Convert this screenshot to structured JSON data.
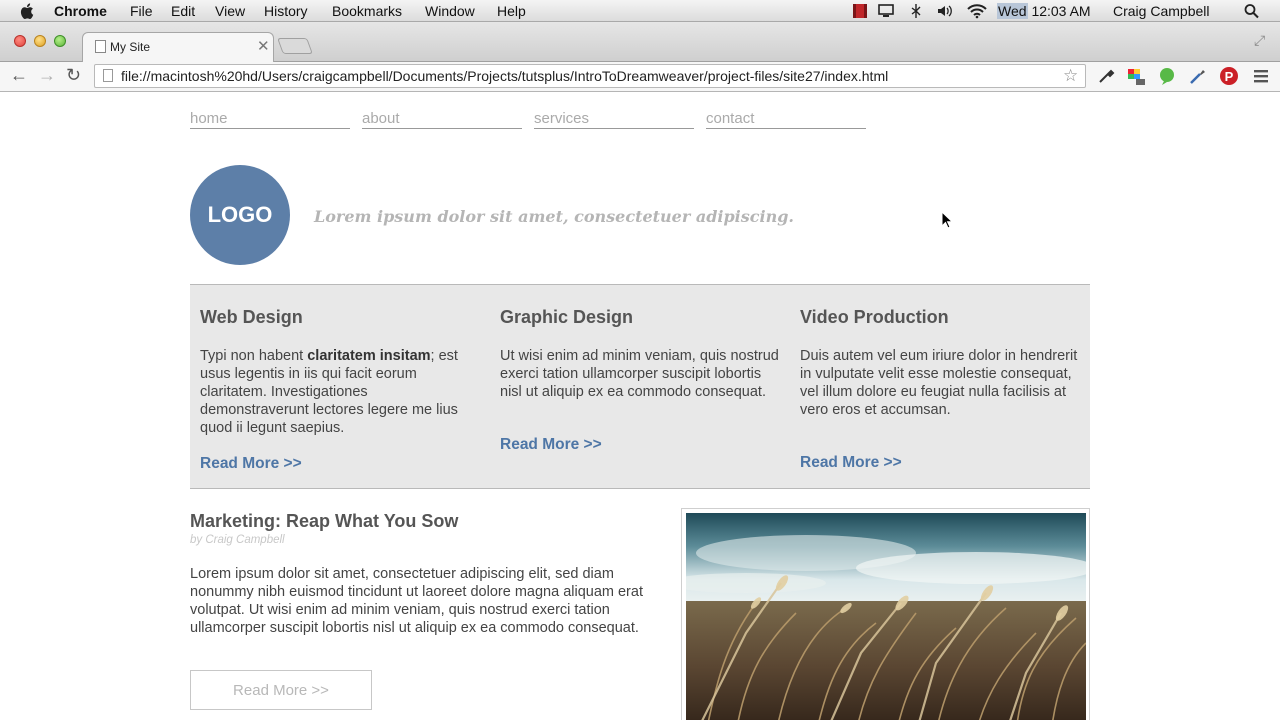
{
  "menubar": {
    "app_name": "Chrome",
    "items": [
      "File",
      "Edit",
      "View",
      "History",
      "Bookmarks",
      "Window",
      "Help"
    ],
    "clock_day": "Wed",
    "clock_time": "12:03 AM",
    "user": "Craig Campbell"
  },
  "browser": {
    "tab_title": "My Site",
    "url": "file://macintosh%20hd/Users/craigcampbell/Documents/Projects/tutsplus/IntroToDreamweaver/project-files/site27/index.html"
  },
  "site": {
    "nav": [
      "home",
      "about",
      "services",
      "contact"
    ],
    "logo_text": "LOGO",
    "tagline": "Lorem ipsum dolor sit amet, consectetuer adipiscing.",
    "services": [
      {
        "title": "Web Design",
        "text_before": "Typi non habent ",
        "text_bold": "claritatem insitam",
        "text_after": "; est usus legentis in iis qui facit eorum claritatem. Investigationes demonstraverunt lectores legere me lius quod ii legunt saepius.",
        "link": "Read More >>"
      },
      {
        "title": "Graphic Design",
        "text": "Ut wisi enim ad minim veniam, quis nostrud exerci tation ullamcorper suscipit lobortis nisl ut aliquip ex ea commodo consequat.",
        "link": "Read More >>"
      },
      {
        "title": "Video Production",
        "text": "Duis autem vel eum iriure dolor in hendrerit in vulputate velit esse molestie consequat, vel illum dolore eu feugiat nulla facilisis at vero eros et accumsan.",
        "link": "Read More >>"
      }
    ],
    "article": {
      "title": "Marketing: Reap What You Sow",
      "byline": "by Craig Campbell",
      "body": "Lorem ipsum dolor sit amet, consectetuer adipiscing elit, sed diam nonummy nibh euismod tincidunt ut laoreet dolore magna aliquam erat volutpat. Ut wisi enim ad minim veniam, quis nostrud exerci tation ullamcorper suscipit lobortis nisl ut aliquip ex ea commodo consequat.",
      "button": "Read More >>"
    }
  },
  "colors": {
    "logo_bg": "#5d7fa8",
    "link": "#4e76a6",
    "services_bg": "#e8e8e8"
  }
}
